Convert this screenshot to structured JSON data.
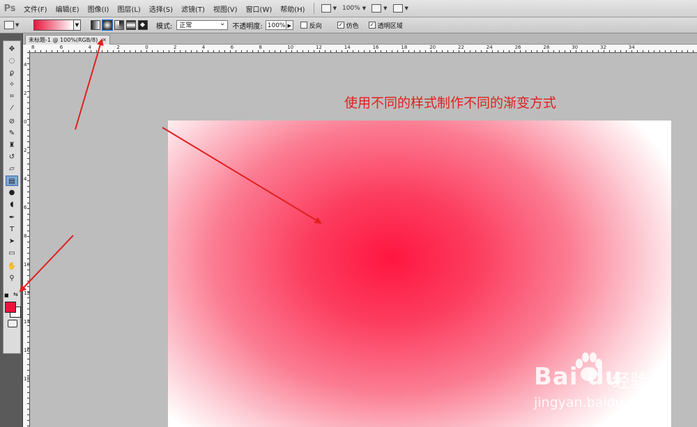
{
  "app": {
    "logo": "Ps"
  },
  "menu": [
    "文件(F)",
    "编辑(E)",
    "图像(I)",
    "图层(L)",
    "选择(S)",
    "滤镜(T)",
    "视图(V)",
    "窗口(W)",
    "帮助(H)"
  ],
  "menubar_controls": {
    "zoom": "100%"
  },
  "options": {
    "mode_label": "模式:",
    "mode_value": "正常",
    "opacity_label": "不透明度:",
    "opacity_value": "100%",
    "reverse_label": "反向",
    "dither_label": "仿色",
    "transparency_label": "透明区域",
    "reverse_checked": false,
    "dither_checked": true,
    "transparency_checked": true,
    "gradient_styles": [
      "linear",
      "radial",
      "angle",
      "reflected",
      "diamond"
    ],
    "active_style": "radial"
  },
  "document": {
    "tab_title": "未标题-1 @ 100%(RGB/8)",
    "close_glyph": "✕"
  },
  "rulers": {
    "top": [
      "8",
      "6",
      "4",
      "2",
      "0",
      "2",
      "4",
      "6",
      "8",
      "10",
      "12",
      "14",
      "16",
      "18",
      "20",
      "22",
      "24",
      "26",
      "28",
      "30",
      "32",
      "34"
    ],
    "left": [
      "4",
      "2",
      "0",
      "2",
      "4",
      "6",
      "8",
      "10",
      "12",
      "14",
      "16",
      "18"
    ]
  },
  "colors": {
    "foreground": "#e8153d",
    "background": "#ffffff",
    "annotation": "#e02020",
    "accent": "#ff1640"
  },
  "annotation": "使用不同的样式制作不同的渐变方式",
  "watermark": {
    "logo": "Bai du",
    "brand": "经验",
    "url": "jingyan.baidu.com"
  },
  "tools": [
    "move-icon",
    "marquee-icon",
    "lasso-icon",
    "magic-wand-icon",
    "crop-icon",
    "eyedropper-icon",
    "healing-brush-icon",
    "brush-icon",
    "clone-stamp-icon",
    "history-brush-icon",
    "eraser-icon",
    "gradient-icon",
    "blur-icon",
    "dodge-icon",
    "pen-icon",
    "type-icon",
    "path-select-icon",
    "shape-icon",
    "hand-icon",
    "zoom-icon"
  ]
}
